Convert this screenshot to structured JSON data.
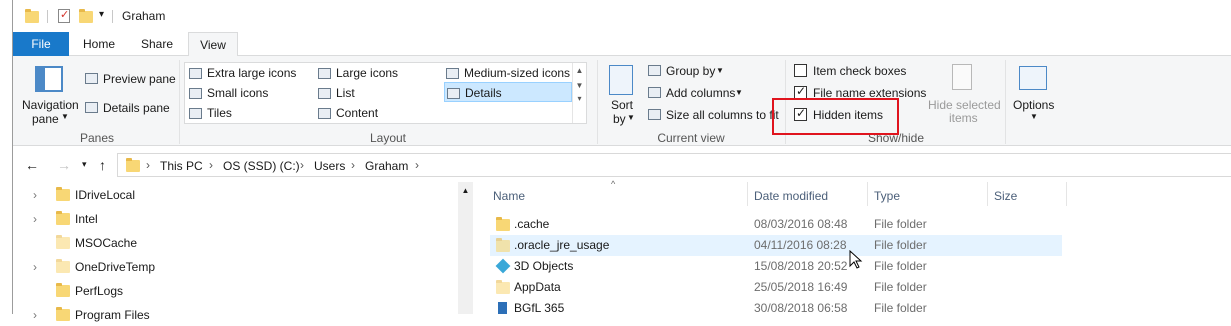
{
  "window": {
    "title": "Graham"
  },
  "tabs": [
    {
      "label": "File"
    },
    {
      "label": "Home"
    },
    {
      "label": "Share"
    },
    {
      "label": "View"
    }
  ],
  "ribbon": {
    "panes": {
      "navigation_pane": "Navigation",
      "navigation_pane_sub": "pane",
      "preview_pane": "Preview pane",
      "details_pane": "Details pane",
      "group_label": "Panes"
    },
    "layout": {
      "items": [
        "Extra large icons",
        "Large icons",
        "Medium-sized icons",
        "Small icons",
        "List",
        "Details",
        "Tiles",
        "Content"
      ],
      "selected": "Details",
      "group_label": "Layout"
    },
    "current_view": {
      "sort_by": "Sort",
      "sort_by_sub": "by",
      "group_by": "Group by",
      "add_columns": "Add columns",
      "size_all_columns": "Size all columns to fit",
      "group_label": "Current view"
    },
    "show_hide": {
      "item_check_boxes": {
        "label": "Item check boxes",
        "checked": false
      },
      "file_name_extensions": {
        "label": "File name extensions",
        "checked": true
      },
      "hidden_items": {
        "label": "Hidden items",
        "checked": true
      },
      "hide_selected_items": "Hide selected",
      "hide_selected_items_sub": "items",
      "group_label": "Show/hide"
    },
    "options": {
      "label": "Options"
    }
  },
  "address": {
    "crumbs": [
      "This PC",
      "OS (SSD) (C:)",
      "Users",
      "Graham"
    ]
  },
  "nav_pane": {
    "items": [
      {
        "label": "IDriveLocal",
        "expandable": true
      },
      {
        "label": "Intel",
        "expandable": true
      },
      {
        "label": "MSOCache",
        "expandable": false
      },
      {
        "label": "OneDriveTemp",
        "expandable": true
      },
      {
        "label": "PerfLogs",
        "expandable": false
      },
      {
        "label": "Program Files",
        "expandable": true
      }
    ]
  },
  "file_list": {
    "columns": [
      "Name",
      "Date modified",
      "Type",
      "Size"
    ],
    "rows": [
      {
        "name": ".cache",
        "date": "08/03/2016 08:48",
        "type": "File folder",
        "icon": "folder-icon"
      },
      {
        "name": ".oracle_jre_usage",
        "date": "04/11/2016 08:28",
        "type": "File folder",
        "icon": "folder-icon"
      },
      {
        "name": "3D Objects",
        "date": "15/08/2018 20:52",
        "type": "File folder",
        "icon": "3d-objects-icon"
      },
      {
        "name": "AppData",
        "date": "25/05/2018 16:49",
        "type": "File folder",
        "icon": "folder-icon"
      },
      {
        "name": "BGfL 365",
        "date": "30/08/2018 06:58",
        "type": "File folder",
        "icon": "onedrive-business-icon"
      }
    ]
  },
  "colors": {
    "accent": "#1979ca",
    "highlight": "#e0141e",
    "selection": "#cce8ff"
  }
}
